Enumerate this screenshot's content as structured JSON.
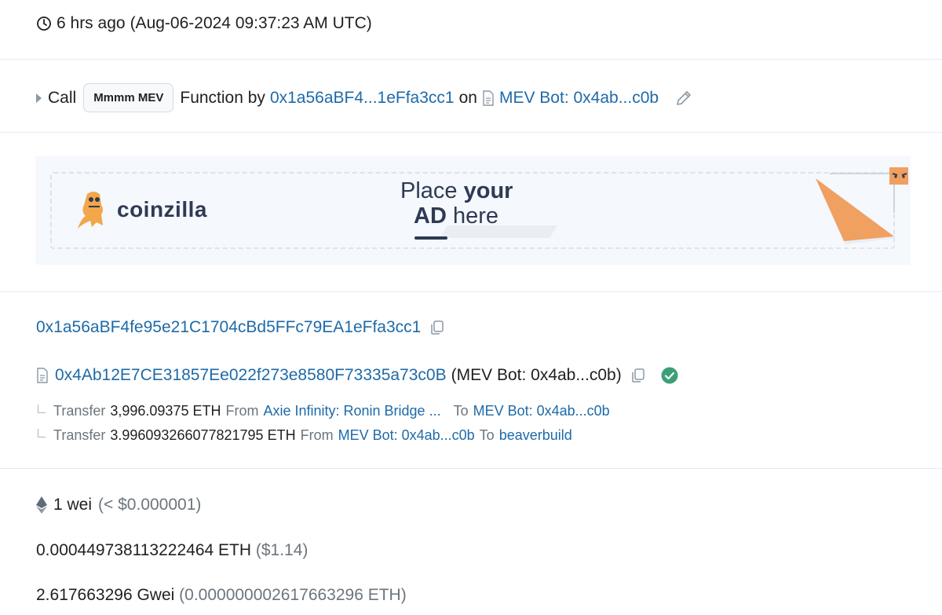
{
  "timestamp": {
    "relative": "6 hrs ago",
    "absolute": "(Aug-06-2024 09:37:23 AM UTC)",
    "icon": "clock-icon"
  },
  "call": {
    "prefix": "Call",
    "method_badge": "Mmmm MEV",
    "function_by": "Function by",
    "caller": "0x1a56aBF4...1eFfa3cc1",
    "on": "on",
    "contract": "MEV Bot: 0x4ab...c0b"
  },
  "ad": {
    "brand": "coinzilla",
    "place_line1_a": "Place",
    "place_line1_b": "your",
    "place_line2_a": "AD",
    "place_line2_b": "here"
  },
  "from": {
    "address": "0x1a56aBF4fe95e21C1704cBd5FFc79EA1eFfa3cc1"
  },
  "to": {
    "address": "0x4Ab12E7CE31857Ee022f273e8580F73335a73c0B",
    "name_tag": "(MEV Bot: 0x4ab...c0b)"
  },
  "transfers": [
    {
      "label": "Transfer",
      "amount": "3,996.09375 ETH",
      "from_label": "From",
      "from": "Axie Infinity: Ronin Bridge ...",
      "to_label": "To",
      "to": "MEV Bot: 0x4ab...c0b"
    },
    {
      "label": "Transfer",
      "amount": "3.996093266077821795 ETH",
      "from_label": "From",
      "from": "MEV Bot: 0x4ab...c0b",
      "to_label": "To",
      "to": "beaverbuild"
    }
  ],
  "value": {
    "amount": "1 wei",
    "usd": "(< $0.000001)"
  },
  "fee": {
    "amount": "0.000449738113222464 ETH",
    "usd": "($1.14)"
  },
  "gas_price": {
    "amount": "2.617663296 Gwei",
    "eth": "(0.000000002617663296 ETH)"
  },
  "colors": {
    "link": "#1e6aa8",
    "success": "#3d9f78",
    "ad_orange": "#f0a060"
  }
}
